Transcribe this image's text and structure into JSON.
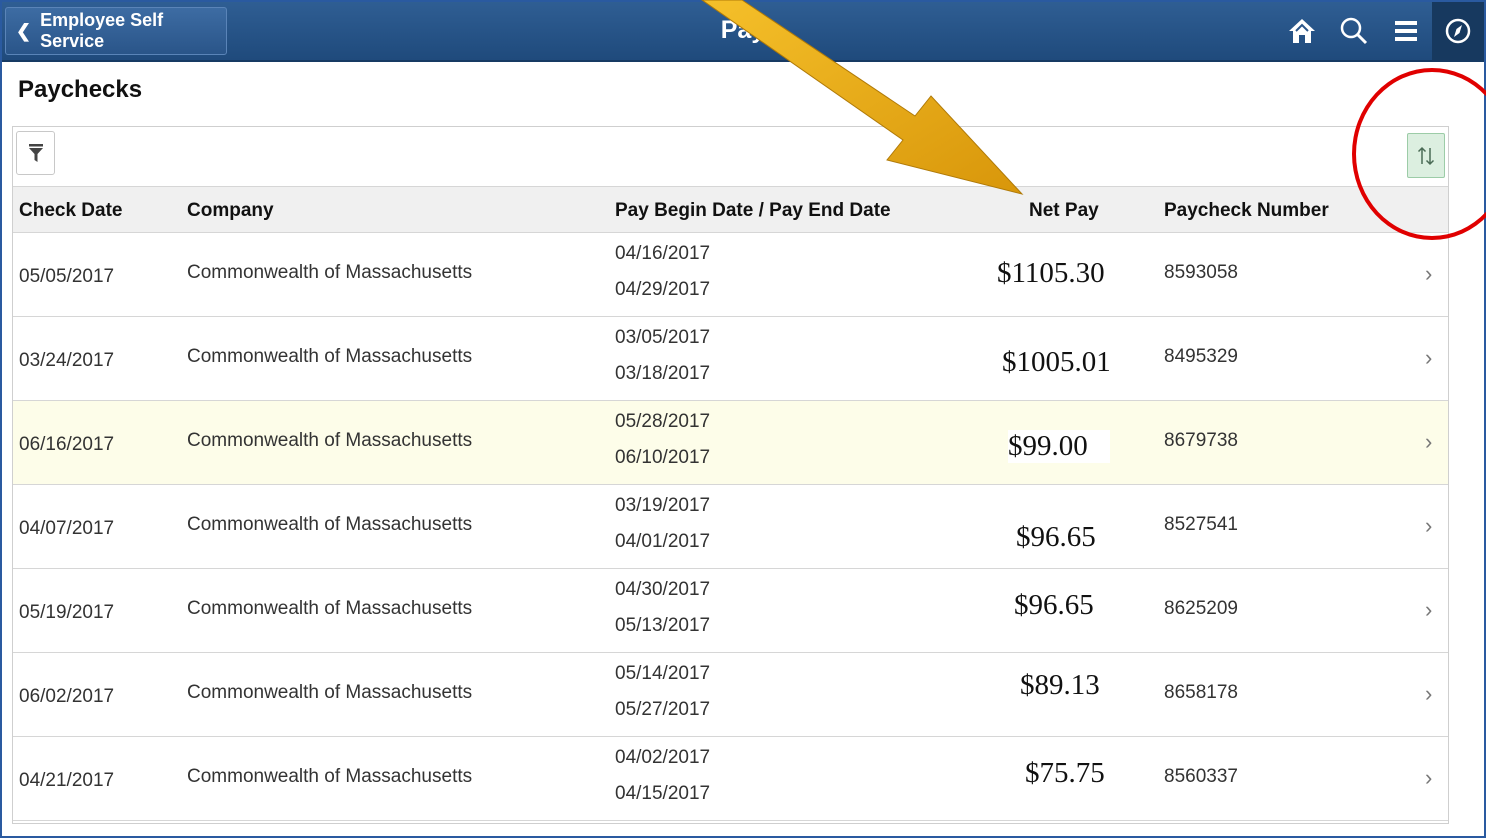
{
  "header": {
    "back_label": "Employee Self Service",
    "title": "Pay",
    "icons": [
      "home-icon",
      "search-icon",
      "menu-icon",
      "navbar-icon"
    ]
  },
  "page": {
    "subtitle": "Paychecks"
  },
  "toolbar": {
    "filter_icon": "filter-icon",
    "sort_icon": "sort-icon"
  },
  "table": {
    "columns": [
      "Check Date",
      "Company",
      "Pay Begin Date / Pay End Date",
      "Net Pay",
      "Paycheck Number"
    ],
    "rows": [
      {
        "check_date": "05/05/2017",
        "company": "Commonwealth of Massachusetts",
        "begin": "04/16/2017",
        "end": "04/29/2017",
        "net_pay": "$1105.30",
        "number": "8593058"
      },
      {
        "check_date": "03/24/2017",
        "company": "Commonwealth of Massachusetts",
        "begin": "03/05/2017",
        "end": "03/18/2017",
        "net_pay": "$1005.01",
        "number": "8495329"
      },
      {
        "check_date": "06/16/2017",
        "company": "Commonwealth of Massachusetts",
        "begin": "05/28/2017",
        "end": "06/10/2017",
        "net_pay": "$99.00",
        "number": "8679738"
      },
      {
        "check_date": "04/07/2017",
        "company": "Commonwealth of Massachusetts",
        "begin": "03/19/2017",
        "end": "04/01/2017",
        "net_pay": "$96.65",
        "number": "8527541"
      },
      {
        "check_date": "05/19/2017",
        "company": "Commonwealth of Massachusetts",
        "begin": "04/30/2017",
        "end": "05/13/2017",
        "net_pay": "$96.65",
        "number": "8625209"
      },
      {
        "check_date": "06/02/2017",
        "company": "Commonwealth of Massachusetts",
        "begin": "05/14/2017",
        "end": "05/27/2017",
        "net_pay": "$89.13",
        "number": "8658178"
      },
      {
        "check_date": "04/21/2017",
        "company": "Commonwealth of Massachusetts",
        "begin": "04/02/2017",
        "end": "04/15/2017",
        "net_pay": "$75.75",
        "number": "8560337"
      }
    ]
  },
  "annotations": {
    "arrow_color": "#e8a90c",
    "circle_color": "#e00000"
  },
  "colors": {
    "header_blue": "#2f5e93",
    "highlight_row": "#fdfde9",
    "sort_button": "#dcefe0"
  }
}
